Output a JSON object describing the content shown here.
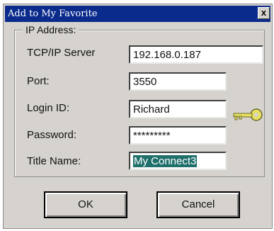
{
  "window": {
    "title": "Add to My Favorite",
    "close_glyph": "x"
  },
  "group": {
    "legend": "IP Address:",
    "fields": [
      {
        "label": "TCP/IP Server",
        "value": "192.168.0.187"
      },
      {
        "label": "Port:",
        "value": "3550"
      },
      {
        "label": "Login ID:",
        "value": "Richard"
      },
      {
        "label": "Password:",
        "value": "*********"
      },
      {
        "label": "Title Name:",
        "value": "My Connect3"
      }
    ]
  },
  "buttons": {
    "ok": "OK",
    "cancel": "Cancel"
  },
  "colors": {
    "titlebar": "#0a2a8c",
    "key": "#e8e060",
    "selection": "#1f6f6b"
  }
}
